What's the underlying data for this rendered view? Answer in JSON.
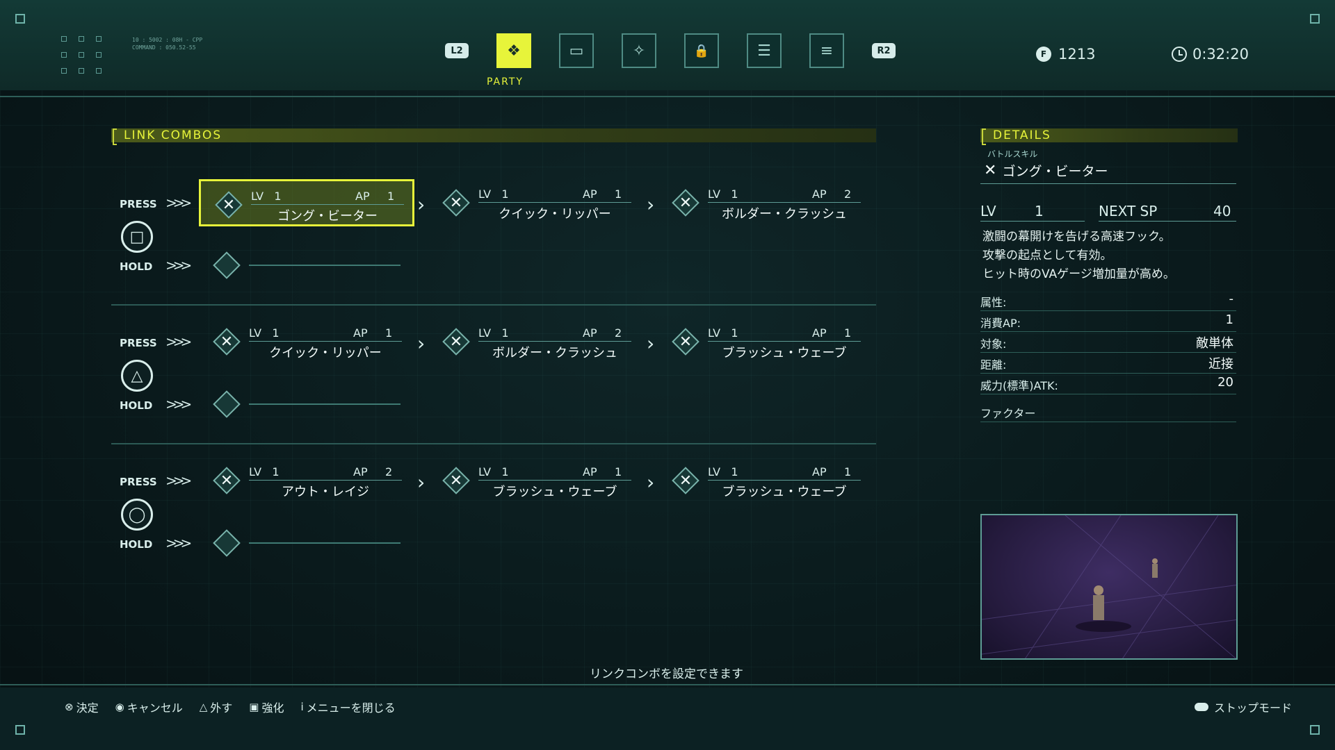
{
  "header": {
    "code_line1": "10 : 5002 : 08H - CPP",
    "code_line2": "COMMAND : 050.52-55",
    "tabs": [
      {
        "name": "tab-party",
        "icon": "party-icon",
        "glyph": "❖",
        "active": true
      },
      {
        "name": "tab-equipment",
        "icon": "equipment-icon",
        "glyph": "▭",
        "active": false
      },
      {
        "name": "tab-abilities",
        "icon": "ability-icon",
        "glyph": "✧",
        "active": false
      },
      {
        "name": "tab-items",
        "icon": "lock-icon",
        "glyph": "🔒",
        "active": false
      },
      {
        "name": "tab-records",
        "icon": "document-icon",
        "glyph": "☰",
        "active": false
      },
      {
        "name": "tab-settings",
        "icon": "settings-icon",
        "glyph": "≡",
        "active": false
      }
    ],
    "left_shoulder": "L2",
    "right_shoulder": "R2",
    "active_tab_label": "PARTY",
    "currency_icon": "F",
    "currency": "1213",
    "playtime": "0:32:20"
  },
  "link_combos": {
    "title": "LINK COMBOS",
    "press_label": "PRESS",
    "hold_label": "HOLD",
    "groups": [
      {
        "button": "square",
        "button_glyph": "□",
        "press": [
          {
            "lv_label": "LV",
            "lv": "1",
            "ap_label": "AP",
            "ap": "1",
            "name": "ゴング・ビーター",
            "selected": true
          },
          {
            "lv_label": "LV",
            "lv": "1",
            "ap_label": "AP",
            "ap": "1",
            "name": "クイック・リッパー"
          },
          {
            "lv_label": "LV",
            "lv": "1",
            "ap_label": "AP",
            "ap": "2",
            "name": "ボルダー・クラッシュ"
          }
        ]
      },
      {
        "button": "triangle",
        "button_glyph": "△",
        "press": [
          {
            "lv_label": "LV",
            "lv": "1",
            "ap_label": "AP",
            "ap": "1",
            "name": "クイック・リッパー"
          },
          {
            "lv_label": "LV",
            "lv": "1",
            "ap_label": "AP",
            "ap": "2",
            "name": "ボルダー・クラッシュ"
          },
          {
            "lv_label": "LV",
            "lv": "1",
            "ap_label": "AP",
            "ap": "1",
            "name": "ブラッシュ・ウェーブ"
          }
        ]
      },
      {
        "button": "circle",
        "button_glyph": "◯",
        "press": [
          {
            "lv_label": "LV",
            "lv": "1",
            "ap_label": "AP",
            "ap": "2",
            "name": "アウト・レイジ"
          },
          {
            "lv_label": "LV",
            "lv": "1",
            "ap_label": "AP",
            "ap": "1",
            "name": "ブラッシュ・ウェーブ"
          },
          {
            "lv_label": "LV",
            "lv": "1",
            "ap_label": "AP",
            "ap": "1",
            "name": "ブラッシュ・ウェーブ"
          }
        ]
      }
    ]
  },
  "details": {
    "title": "DETAILS",
    "category": "バトルスキル",
    "name": "ゴング・ビーター",
    "lv_label": "LV",
    "lv": "1",
    "next_sp_label": "NEXT SP",
    "next_sp": "40",
    "description": [
      "激闘の幕開けを告げる高速フック。",
      "攻撃の起点として有効。",
      "ヒット時のVAゲージ増加量が高め。"
    ],
    "stats": [
      {
        "key": "属性:",
        "value": "-"
      },
      {
        "key": "消費AP:",
        "value": "1"
      },
      {
        "key": "対象:",
        "value": "敵単体"
      },
      {
        "key": "距離:",
        "value": "近接"
      },
      {
        "key": "威力(標準)ATK:",
        "value": "20"
      }
    ],
    "factor_label": "ファクター"
  },
  "hint": "リンクコンボを設定できます",
  "footer": {
    "items": [
      {
        "glyph": "⊗",
        "label": "決定"
      },
      {
        "glyph": "◉",
        "label": "キャンセル"
      },
      {
        "glyph": "△",
        "label": "外す"
      },
      {
        "glyph": "▣",
        "label": "強化"
      },
      {
        "glyph": "i",
        "label": "メニューを閉じる"
      }
    ],
    "right_label": "ストップモード"
  },
  "colors": {
    "accent": "#e7f43a",
    "panel": "#0f2a28",
    "line": "#5e9c95"
  }
}
